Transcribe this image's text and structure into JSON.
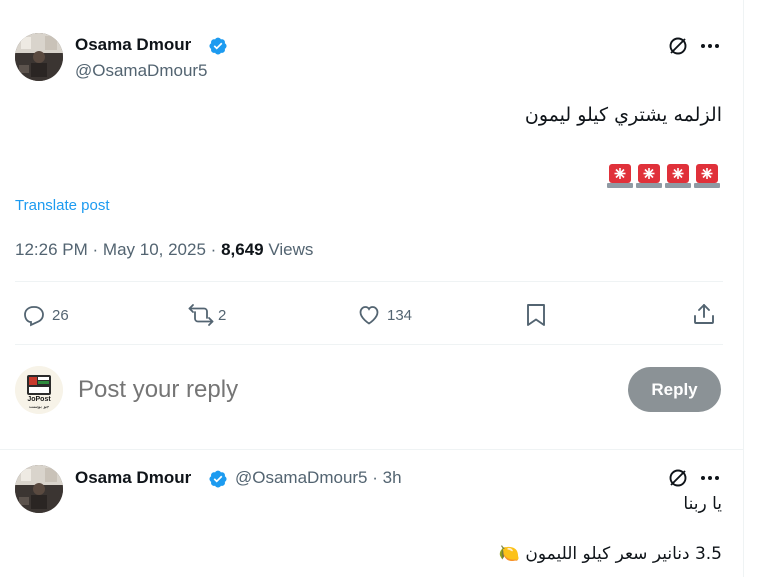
{
  "tweet": {
    "display_name": "Osama Dmour",
    "handle": "@OsamaDmour5",
    "text": "الزلمه يشتري كيلو ليمون",
    "emoji_text": "🚨🚨🚨🚨",
    "translate_label": "Translate post",
    "time": "12:26 PM",
    "date": "May 10, 2025",
    "views_count": "8,649",
    "views_label": "Views",
    "separator": "·"
  },
  "actions": {
    "replies": "26",
    "reposts": "2",
    "likes": "134"
  },
  "composer": {
    "placeholder": "Post your reply",
    "reply_button": "Reply",
    "avatar_text_top": "JoPost",
    "avatar_text_bottom": "جو بوست"
  },
  "reply": {
    "display_name": "Osama Dmour",
    "handle": "@OsamaDmour5",
    "separator": "·",
    "time_ago": "3h",
    "line1": "يا ربنا",
    "line2": "3.5 دنانير سعر كيلو الليمون 🍋"
  },
  "colors": {
    "verified": "#1d9bf0",
    "link": "#1d9bf0",
    "muted": "#536471",
    "reply_button_bg": "#8b9296"
  },
  "icons": {
    "grok": "grok-icon",
    "more": "more-icon",
    "reply": "reply-icon",
    "repost": "repost-icon",
    "like": "heart-icon",
    "bookmark": "bookmark-icon",
    "share": "share-icon",
    "verified": "verified-badge-icon"
  }
}
